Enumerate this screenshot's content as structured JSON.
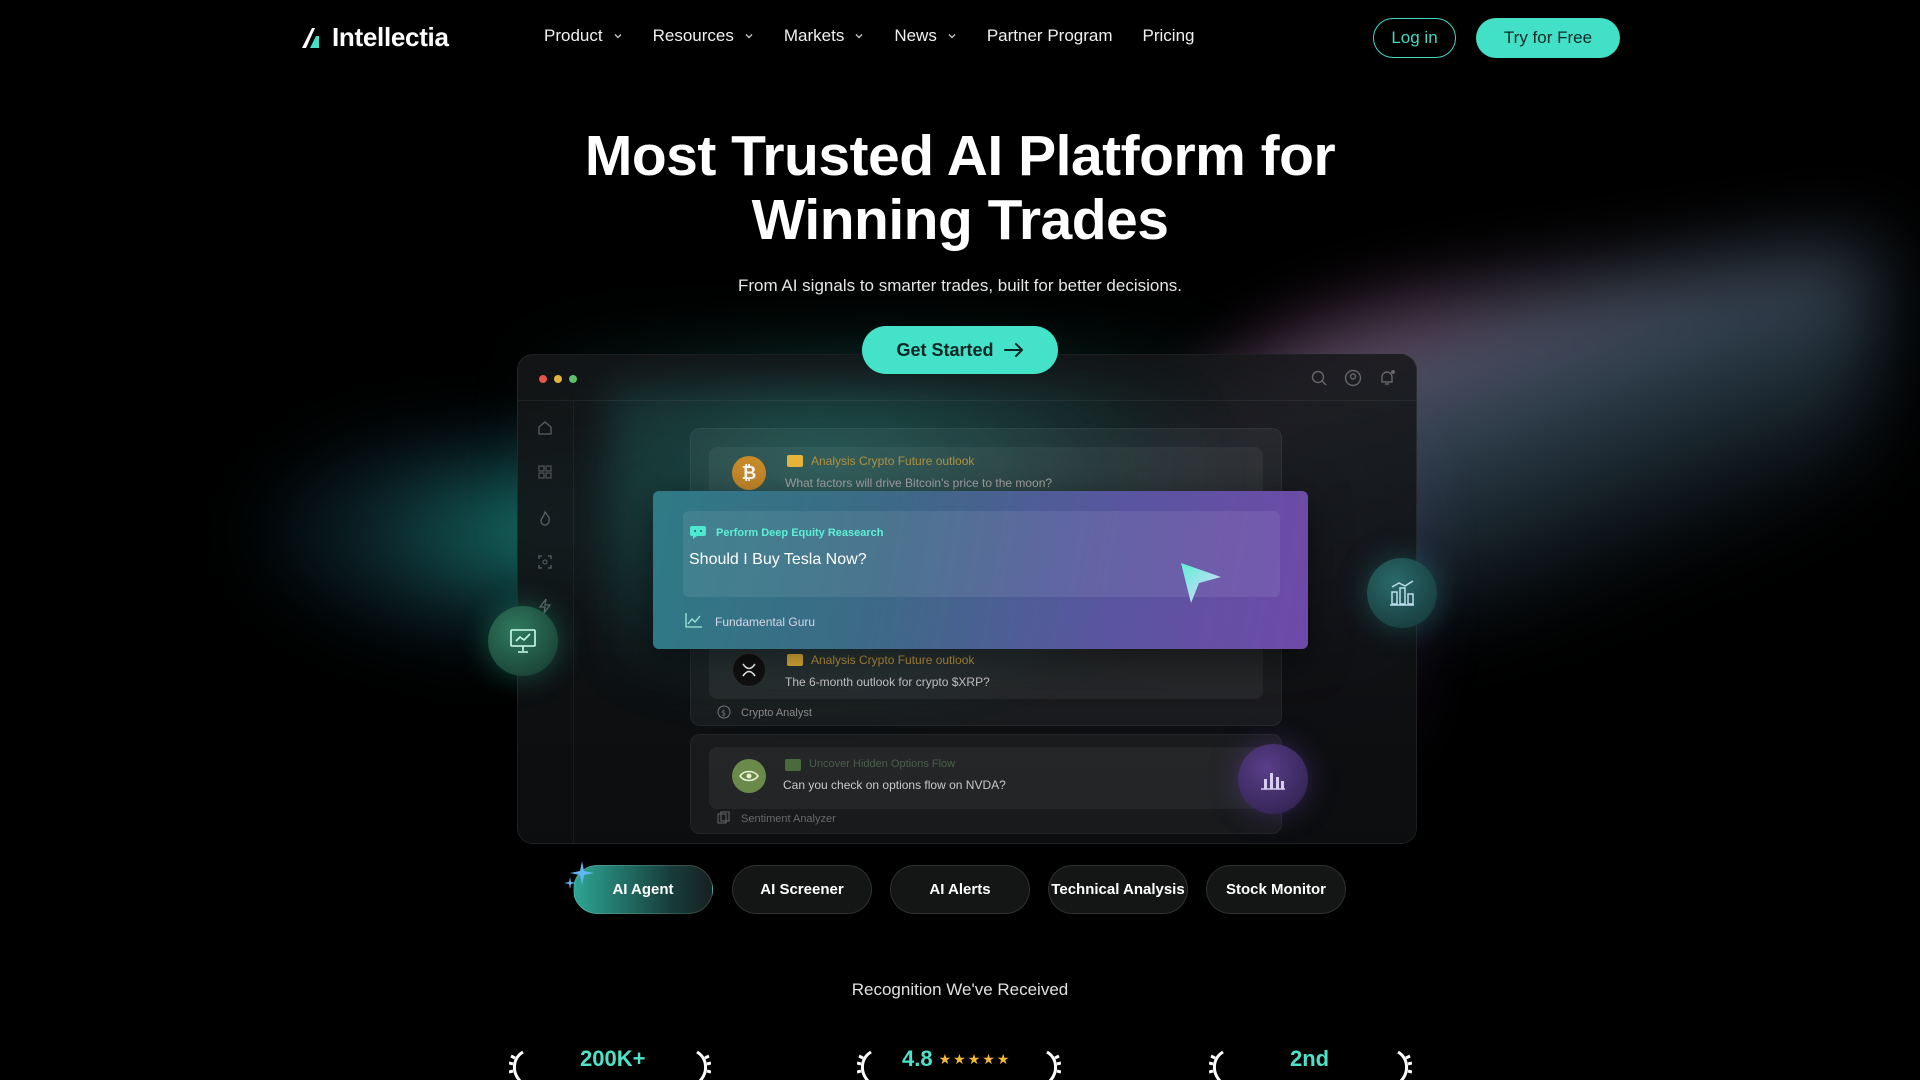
{
  "brand": {
    "name": "Intellectia",
    "accent": "#42e0c6"
  },
  "nav": {
    "items": [
      {
        "label": "Product",
        "dropdown": true
      },
      {
        "label": "Resources",
        "dropdown": true
      },
      {
        "label": "Markets",
        "dropdown": true
      },
      {
        "label": "News",
        "dropdown": true
      },
      {
        "label": "Partner Program",
        "dropdown": false
      },
      {
        "label": "Pricing",
        "dropdown": false
      }
    ],
    "login_label": "Log in",
    "try_label": "Try for Free"
  },
  "hero": {
    "title_line1": "Most Trusted AI Platform for",
    "title_line2": "Winning Trades",
    "subtitle": "From AI signals to smarter trades, built for better decisions.",
    "cta_label": "Get Started"
  },
  "app": {
    "cards": [
      {
        "tag": "Analysis Crypto Future outlook",
        "question": "What factors will drive Bitcoin's price to the moon?",
        "coin": "bitcoin-icon"
      },
      {
        "tag": "Analysis Crypto Future outlook",
        "question": "The 6-month outlook for crypto $XRP?",
        "coin": "xrp-icon",
        "footer": "Crypto Analyst"
      },
      {
        "tag": "Uncover Hidden Options Flow",
        "question": "Can you check on options flow on NVDA?",
        "coin": "nvidia-icon",
        "footer": "Sentiment Analyzer"
      }
    ],
    "feature": {
      "tag": "Perform Deep Equity Reasearch",
      "question": "Should I Buy Tesla Now?",
      "footer": "Fundamental Guru"
    }
  },
  "tabs": [
    {
      "label": "AI Agent",
      "active": true
    },
    {
      "label": "AI Screener",
      "active": false
    },
    {
      "label": "AI Alerts",
      "active": false
    },
    {
      "label": "Technical Analysis",
      "active": false
    },
    {
      "label": "Stock Monitor",
      "active": false
    }
  ],
  "recognition": {
    "title": "Recognition We've Received",
    "awards": [
      {
        "value": "200K+"
      },
      {
        "value": "4.8",
        "stars": 5
      },
      {
        "value": "2nd"
      }
    ]
  }
}
